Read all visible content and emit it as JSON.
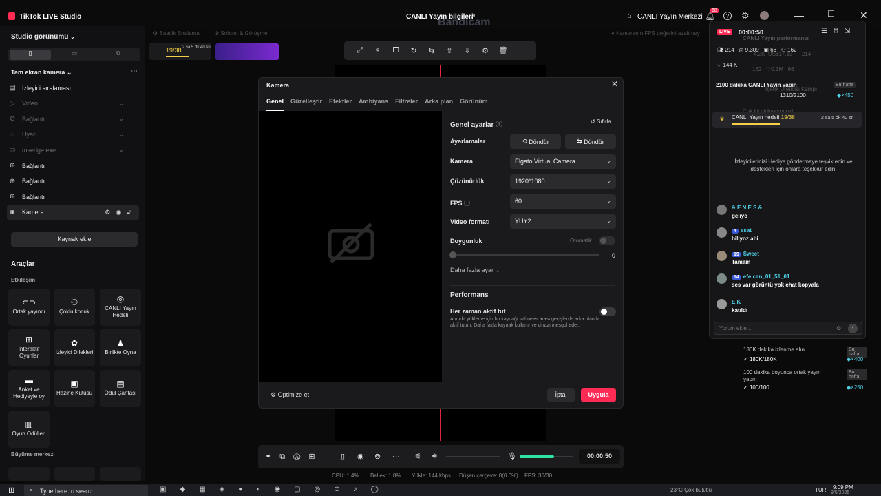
{
  "app": {
    "title": "TikTok LIVE Studio",
    "center_title": "CANLI Yayın bilgileri",
    "live_center": "CANLI Yayın Merkezi",
    "notif_count": "68"
  },
  "left": {
    "studio_view": "Studio görünümü",
    "scene_title": "Tam ekran kamera",
    "sources": [
      {
        "label": "İzleyici sıralaması",
        "dim": false,
        "icon": "ranking-icon"
      },
      {
        "label": "Video",
        "dim": true,
        "icon": "video-icon"
      },
      {
        "label": "Bağlantı",
        "dim": true,
        "icon": "link-icon"
      },
      {
        "label": "Uyarı",
        "dim": true,
        "icon": "alert-icon"
      },
      {
        "label": "msedge.exe",
        "dim": true,
        "icon": "window-icon"
      },
      {
        "label": "Bağlantı",
        "dim": false,
        "icon": "globe-icon"
      },
      {
        "label": "Bağlantı",
        "dim": false,
        "icon": "globe-icon"
      },
      {
        "label": "Bağlantı",
        "dim": false,
        "icon": "globe-icon"
      },
      {
        "label": "Kamera",
        "dim": false,
        "icon": "camera-icon"
      }
    ],
    "add_source": "Kaynak ekle",
    "tools_title": "Araçlar",
    "interaction_title": "Etkileşim",
    "tiles": [
      {
        "label": "Ortak yayıncı",
        "icon": "co-host-icon"
      },
      {
        "label": "Çoklu konuk",
        "icon": "multi-guest-icon"
      },
      {
        "label": "CANLI Yayın Hedefi",
        "icon": "live-goal-icon"
      },
      {
        "label": "İnteraktif Oyunlar",
        "icon": "gamepad-icon"
      },
      {
        "label": "İzleyici Dilekleri",
        "icon": "gift-wish-icon"
      },
      {
        "label": "Birlikte Oyna",
        "icon": "play-together-icon"
      },
      {
        "label": "Anket ve Hediyeyle oy",
        "icon": "poll-icon"
      },
      {
        "label": "Hazine Kutusu",
        "icon": "treasure-icon"
      },
      {
        "label": "Ödül Çantası",
        "icon": "reward-bag-icon"
      },
      {
        "label": "Oyun Ödülleri",
        "icon": "game-reward-icon"
      }
    ],
    "growth_title": "Büyüme merkezi"
  },
  "background": {
    "tab1": "Saatlik Sıralama",
    "tab2": "Sohbet & Görüşme",
    "fps_hint": "Kameranın FPS değerini azaltmay",
    "goal_progress": "19/38",
    "goal_time": "2 sa 5 dk 40 sn",
    "watermark": "Bandicam"
  },
  "modal": {
    "title": "Kamera",
    "tabs": [
      "Genel",
      "Güzelleştir",
      "Efektler",
      "Ambiyans",
      "Filtreler",
      "Arka plan",
      "Görünüm"
    ],
    "general_settings": "Genel ayarlar",
    "reset": "Sıfırla",
    "adjustments": "Ayarlamalar",
    "rotate1": "Döndür",
    "rotate2": "Döndür",
    "camera_label": "Kamera",
    "camera_value": "Elgato Virtual Camera",
    "resolution_label": "Çözünürlük",
    "resolution_value": "1920*1080",
    "fps_label": "FPS",
    "fps_value": "60",
    "format_label": "Video formatı",
    "format_value": "YUY2",
    "saturation_label": "Doygunluk",
    "auto_label": "Otomatik",
    "saturation_value": "0",
    "more_settings": "Daha fazla ayar",
    "performance_title": "Performans",
    "always_active": "Her zaman aktif tut",
    "always_active_desc": "Anında yükleme için bu kaynağı sahneler arası geçişlerde arka planda aktif tutun. Daha fazla kaynak kullanır ve cihazı meşgul eder.",
    "optimize": "Optimize et",
    "cancel": "İptal",
    "apply": "Uygula"
  },
  "controls": {
    "timer": "00:00:50",
    "stats": {
      "cpu": "CPU: 1.4%",
      "memory": "Bellek: 1.8%",
      "upload": "Yükle: 144 kbps",
      "dropped": "Düşen çerçeve: 0(0.0%)",
      "fps": "FPS: 30/30"
    }
  },
  "right": {
    "live_badge": "LIVE",
    "timer": "00:00:50",
    "perf_title": "CANLI Yayın performansı",
    "stats_row1": [
      "214",
      "9.309",
      "66",
      "162"
    ],
    "stats_row1b": [
      "4.2K",
      "US$17.13",
      "214"
    ],
    "stats_row2": [
      "144 K",
      "162",
      "0.1M",
      "66"
    ],
    "task_title": "2100 dakika CANLI Yayın yapın",
    "task_badge": "Bu hafta",
    "task_progress": "1310/2100",
    "task_reward": "×450",
    "creator_camp": "İçerik Üreticisi Kampı",
    "going_well": "Çok iyi gidiyorsunuz!",
    "goal_label": "CANLI Yayın hedefi",
    "goal_value": "19/38",
    "goal_time": "2 sa 5 dk 40 sn",
    "thank_msg": "İzleyicilerinizi Hediye göndermeye teşvik edin ve destekleri için onlara teşekkür edin.",
    "chats": [
      {
        "user": "& E N E S & ",
        "level": "",
        "msg": "geliyo"
      },
      {
        "user": "esat",
        "level": "4",
        "msg": "biliyoz abi"
      },
      {
        "user": "Sweet",
        "level": "19",
        "msg": "Tamam"
      },
      {
        "user": "efe can_01_51_01",
        "level": "14",
        "msg": "ses var görüntü yok chat kopyala"
      },
      {
        "user": "E.K",
        "level": "",
        "msg": "katıldı"
      }
    ],
    "comment_placeholder": "Yorum ekle..."
  },
  "behind": [
    {
      "title": "180K dakika izlenme alın",
      "badge": "Bu hafta",
      "progress": "180K/180K",
      "reward": "×400"
    },
    {
      "title": "100 dakika boyunca ortak yayın yapın",
      "badge": "Bu hafta",
      "progress": "100/100",
      "reward": "×250"
    }
  ],
  "taskbar": {
    "search": "Type here to search",
    "weather": "23°C  Çok bulutlu",
    "lang": "TUR",
    "time": "9:09 PM",
    "date": "9/5/2025"
  }
}
